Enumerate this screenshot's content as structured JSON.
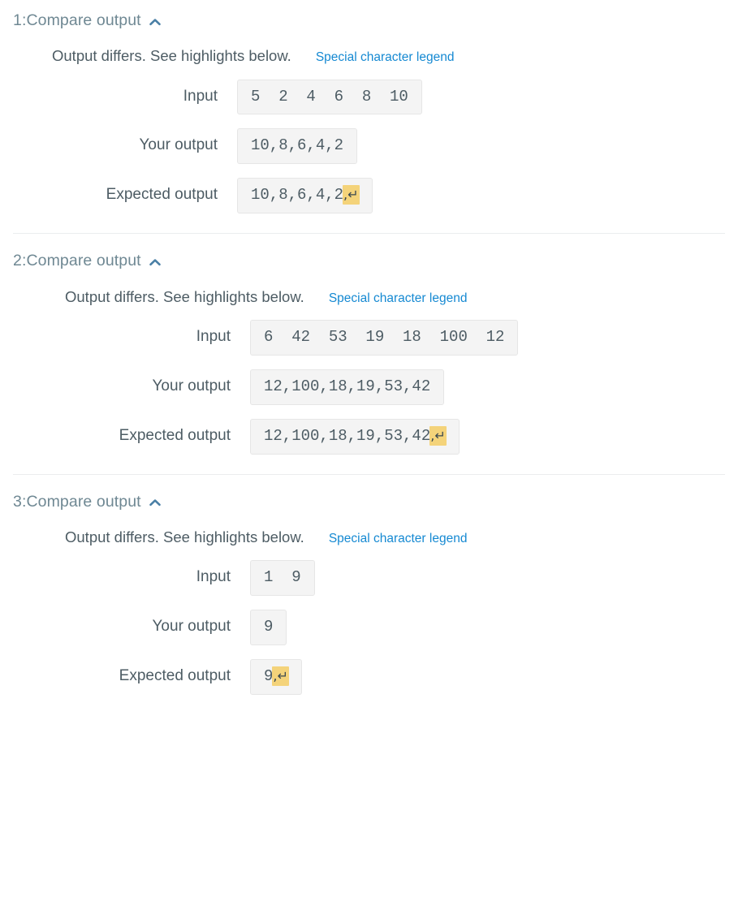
{
  "page": {
    "accent_link_color": "#1589d2",
    "title_color": "#6f8893",
    "text_color": "#4d5c64",
    "highlight_color": "#f4d37a",
    "value_bg_color": "#f4f4f4"
  },
  "labels": {
    "input": "Input",
    "your_output": "Your output",
    "expected_output": "Expected output",
    "legend_link": "Special character legend",
    "chevron_icon": "chevron-up-icon"
  },
  "cases": [
    {
      "title": "1:Compare output",
      "status": "Output differs. See highlights below.",
      "input": "5  2  4  6  8  10",
      "your_output": "10,8,6,4,2",
      "expected_output_text": "10,8,6,4,2",
      "expected_output_highlight": ",↵"
    },
    {
      "title": "2:Compare output",
      "status": "Output differs. See highlights below.",
      "input": "6  42  53  19  18  100  12",
      "your_output": "12,100,18,19,53,42",
      "expected_output_text": "12,100,18,19,53,42",
      "expected_output_highlight": ",↵"
    },
    {
      "title": "3:Compare output",
      "status": "Output differs. See highlights below.",
      "input": "1  9",
      "your_output": "9",
      "expected_output_text": "9",
      "expected_output_highlight": ",↵"
    }
  ]
}
